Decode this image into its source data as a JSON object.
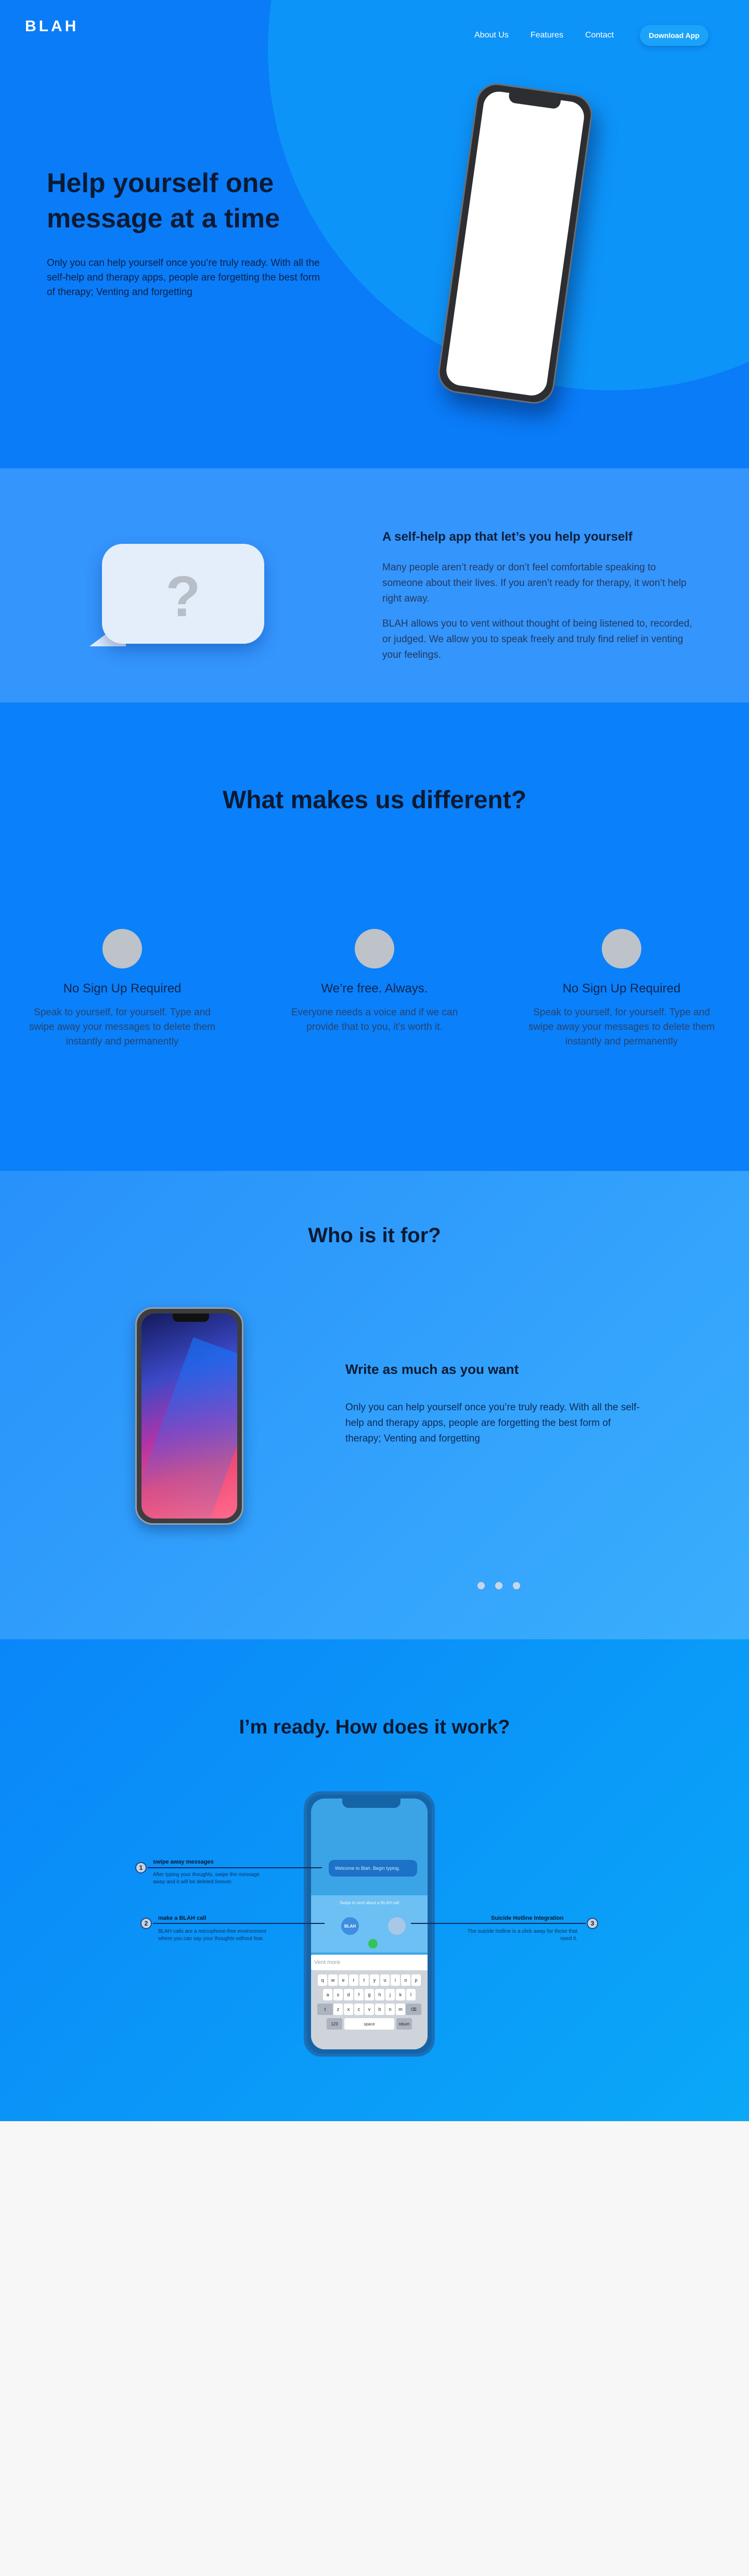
{
  "header": {
    "logo": "BLAH",
    "nav": [
      "About Us",
      "Features",
      "Contact"
    ],
    "cta": "Download App"
  },
  "hero": {
    "title": "Help yourself one message at a time",
    "text": "Only you can help yourself once you’re truly ready. With all the self-help and therapy apps, people are forgetting the best form of therapy; Venting and forgetting"
  },
  "about": {
    "icon": "question-bubble-icon",
    "bubble_glyph": "?",
    "title": "A self-help app that let’s you help yourself",
    "p1": "Many people aren’t ready or don’t feel comfortable speaking to someone about their lives. If you aren’t ready for therapy, it won’t help right away.",
    "p2": "BLAH allows you to vent without thought of being listened to, recorded, or judged. We allow you to speak freely and truly find relief in venting your feelings."
  },
  "features": {
    "title": "What makes us different?",
    "items": [
      {
        "title": "No Sign Up Required",
        "text": "Speak to yourself, for yourself. Type and swipe away your messages to delete them instantly and permanently"
      },
      {
        "title": "We’re free. Always.",
        "text": "Everyone needs a voice and if we can provide that to you, it’s worth it."
      },
      {
        "title": "No Sign Up Required",
        "text": "Speak to yourself, for yourself. Type and swipe away your messages to delete them instantly and permanently"
      }
    ]
  },
  "who": {
    "title": "Who is it for?",
    "subtitle": "Write as much as you want",
    "text": "Only you can help yourself once you’re truly ready. With all the self-help and therapy apps, people are forgetting the best form of therapy; Venting and forgetting",
    "slides": 3
  },
  "how": {
    "title": "I’m ready. How does it work?",
    "phone": {
      "chat_bubble": "Welcome to Blah. Begin typing.",
      "call_label": "Swipe to vent about a BLAH call",
      "logo": "BLAH",
      "input_placeholder": "Vent more",
      "keys_row1": [
        "q",
        "w",
        "e",
        "r",
        "t",
        "y",
        "u",
        "i",
        "o",
        "p"
      ],
      "keys_row2": [
        "a",
        "s",
        "d",
        "f",
        "g",
        "h",
        "j",
        "k",
        "l"
      ],
      "keys_row3": [
        "z",
        "x",
        "c",
        "v",
        "b",
        "n",
        "m"
      ],
      "key_mod_left": "123",
      "key_space": "space",
      "key_return": "return"
    },
    "steps": [
      {
        "num": "1",
        "title": "swipe away messages",
        "text": "After typing your thoughts, swipe the message away and it will be deleted forever."
      },
      {
        "num": "2",
        "title": "make a BLAH call",
        "text": "BLAH calls are a microphone-free environment where you can say your thoughts without fear."
      },
      {
        "num": "3",
        "title": "Suicide Hotline Integration",
        "text": "The suicide hotline is a click away for those that need it."
      }
    ]
  }
}
